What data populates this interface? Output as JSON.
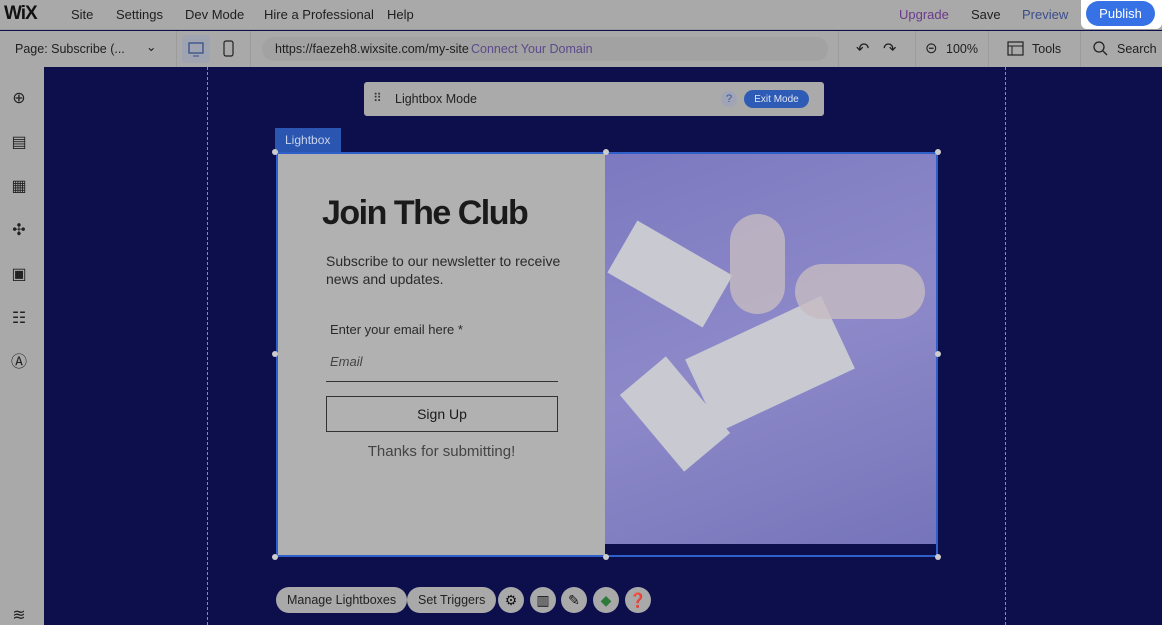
{
  "topbar": {
    "logo": "WiX",
    "menu": [
      "Site",
      "Settings",
      "Dev Mode",
      "Hire a Professional",
      "Help"
    ],
    "upgrade": "Upgrade",
    "save": "Save",
    "preview": "Preview",
    "publish": "Publish"
  },
  "toolbar": {
    "page": "Page: Subscribe (...",
    "url": "https://faezeh8.wixsite.com/my-site",
    "connect": "Connect Your Domain",
    "zoom": "100%",
    "tools": "Tools",
    "search": "Search"
  },
  "mode_bar": {
    "label": "Lightbox Mode",
    "help": "?",
    "exit": "Exit Mode"
  },
  "lightbox": {
    "tag": "Lightbox",
    "title": "Join The Club",
    "subtitle": "Subscribe to our newsletter to receive news and updates.",
    "email_label": "Enter your email here *",
    "email_placeholder": "Email",
    "signup": "Sign Up",
    "thanks": "Thanks for submitting!"
  },
  "bottom": {
    "manage": "Manage Lightboxes",
    "triggers": "Set Triggers"
  },
  "colors": {
    "accent": "#3672e6",
    "canvas": "#0c0f4c",
    "upgrade": "#6a3a8a",
    "connect": "#6a4a9a"
  }
}
